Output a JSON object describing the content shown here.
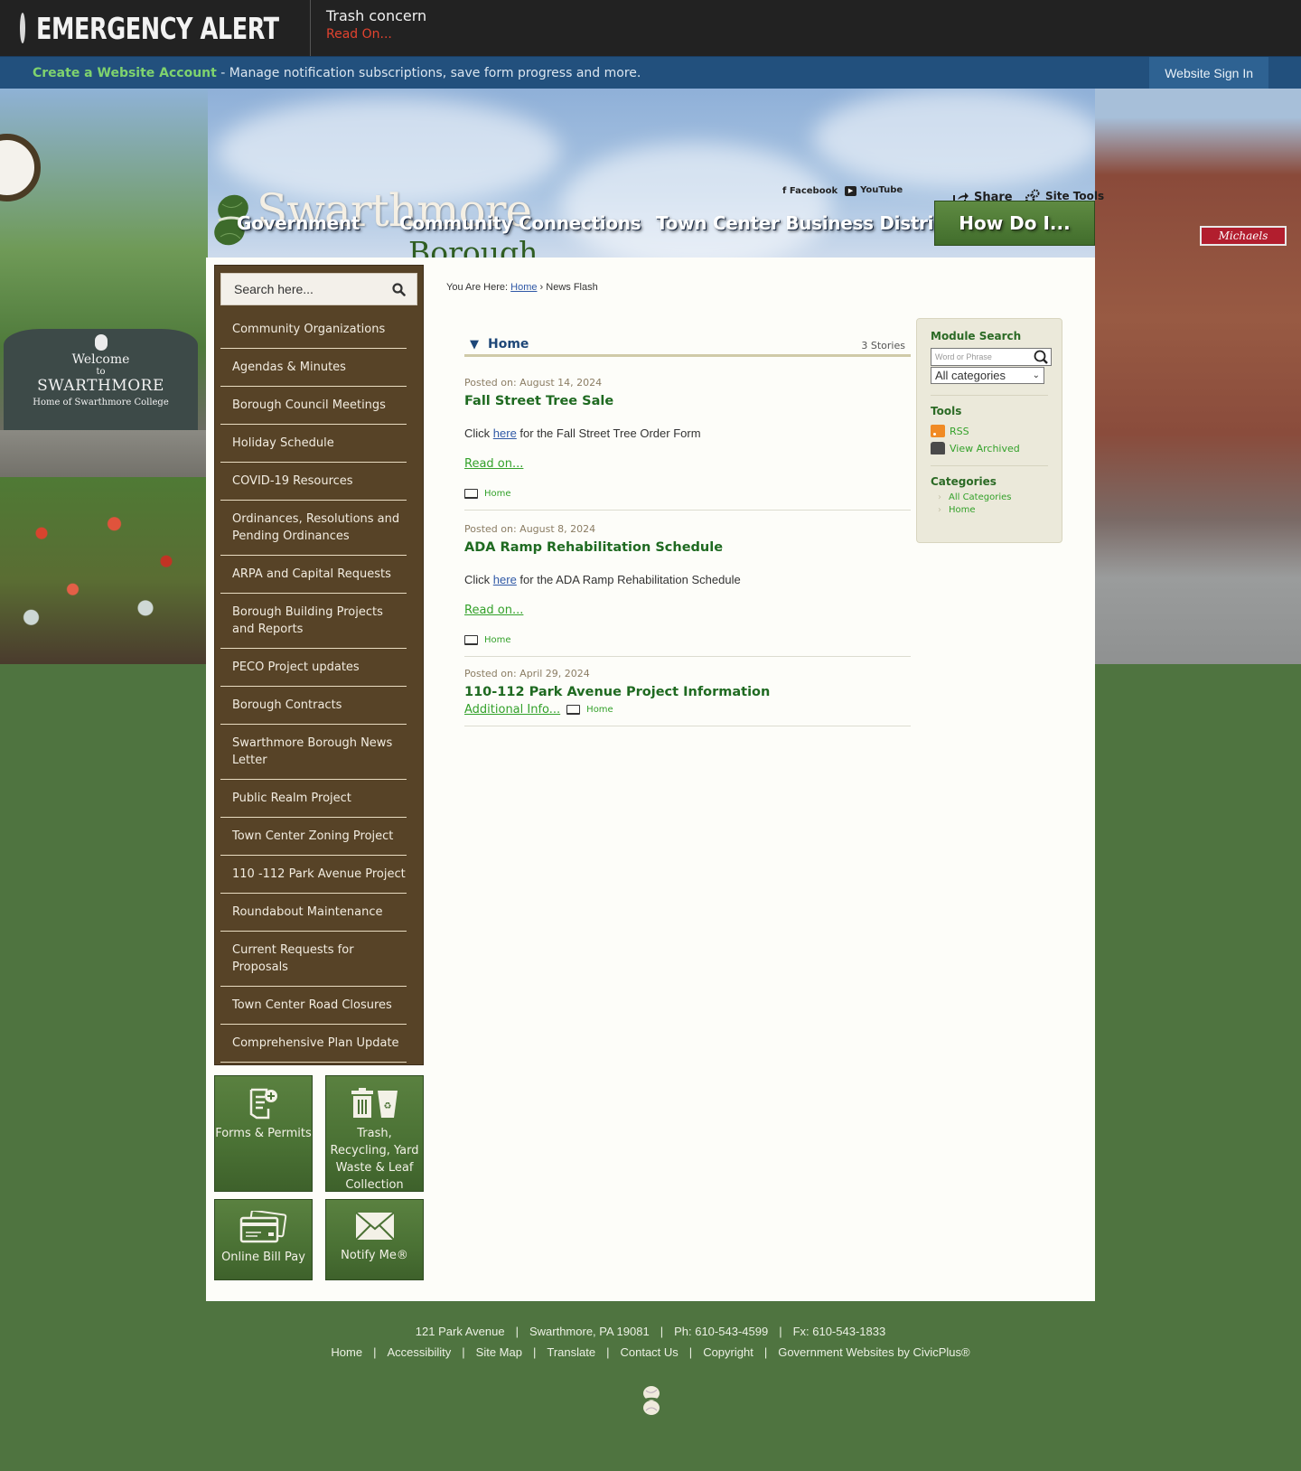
{
  "alert": {
    "title": "EMERGENCY ALERT",
    "message": "Trash concern",
    "read_on": "Read On..."
  },
  "account_bar": {
    "create_link": "Create a Website Account",
    "description": " - Manage notification subscriptions, save form progress and more.",
    "sign_in": "Website Sign In"
  },
  "header": {
    "logo_main": "Swarthmore",
    "logo_sub": "Borough",
    "social": {
      "facebook": "Facebook",
      "youtube": "YouTube"
    },
    "share": "Share",
    "site_tools": "Site Tools",
    "nav": [
      "Government",
      "Community Connections",
      "Town Center Business District"
    ],
    "how_do_i": "How Do I..."
  },
  "hero": {
    "welcome_sign": {
      "line1": "Welcome",
      "line2": "to",
      "line3": "SWARTHMORE",
      "line4": "Home of Swarthmore College"
    },
    "storefront_sign": "Michaels"
  },
  "sidebar": {
    "search_placeholder": "Search here...",
    "items": [
      "Community Organizations",
      "Agendas & Minutes",
      "Borough Council Meetings",
      "Holiday Schedule",
      "COVID-19 Resources",
      "Ordinances, Resolutions and Pending Ordinances",
      "ARPA and Capital Requests",
      "Borough Building Projects and Reports",
      "PECO Project updates",
      "Borough Contracts",
      "Swarthmore Borough News Letter",
      "Public Realm Project",
      "Town Center Zoning Project",
      "110 -112 Park Avenue Project",
      "Roundabout Maintenance",
      "Current Requests for Proposals",
      "Town Center Road Closures",
      "Comprehensive Plan Update"
    ],
    "tiles": [
      {
        "label": "Forms & Permits",
        "icon": "form-icon"
      },
      {
        "label": "Trash, Recycling, Yard Waste & Leaf Collection",
        "icon": "trash-recycle-icon"
      },
      {
        "label": "Online Bill Pay",
        "icon": "credit-card-icon"
      },
      {
        "label": "Notify Me®",
        "icon": "envelope-icon"
      }
    ]
  },
  "breadcrumb": {
    "prefix": "You Are Here: ",
    "home": "Home",
    "separator": " › ",
    "current": "News Flash"
  },
  "news": {
    "category": "Home",
    "count": "3 Stories",
    "stories": [
      {
        "posted": "Posted on: August 14, 2024",
        "title": "Fall Street Tree Sale",
        "body_pre": "Click ",
        "body_link": "here",
        "body_post": " for the Fall Street Tree Order Form",
        "read_on": "Read on...",
        "category": "Home"
      },
      {
        "posted": "Posted on: August 8, 2024",
        "title": "ADA Ramp Rehabilitation Schedule",
        "body_pre": "Click ",
        "body_link": "here",
        "body_post": " for the ADA Ramp Rehabilitation Schedule",
        "read_on": "Read on...",
        "category": "Home"
      },
      {
        "posted": "Posted on: April 29, 2024",
        "title": "110-112 Park Avenue Project Information",
        "read_on": "Additional Info...",
        "category": "Home"
      }
    ]
  },
  "module": {
    "search_title": "Module Search",
    "search_placeholder": "Word or Phrase",
    "category_select": "All categories",
    "tools_title": "Tools",
    "tools": [
      "RSS",
      "View Archived"
    ],
    "categories_title": "Categories",
    "categories": [
      "All Categories",
      "Home"
    ]
  },
  "footer": {
    "address": [
      "121 Park Avenue",
      "Swarthmore, PA 19081",
      "Ph: 610-543-4599",
      "Fx: 610-543-1833"
    ],
    "links": [
      "Home",
      "Accessibility",
      "Site Map",
      "Translate",
      "Contact Us",
      "Copyright",
      "Government Websites by CivicPlus®"
    ],
    "separator": "|"
  }
}
